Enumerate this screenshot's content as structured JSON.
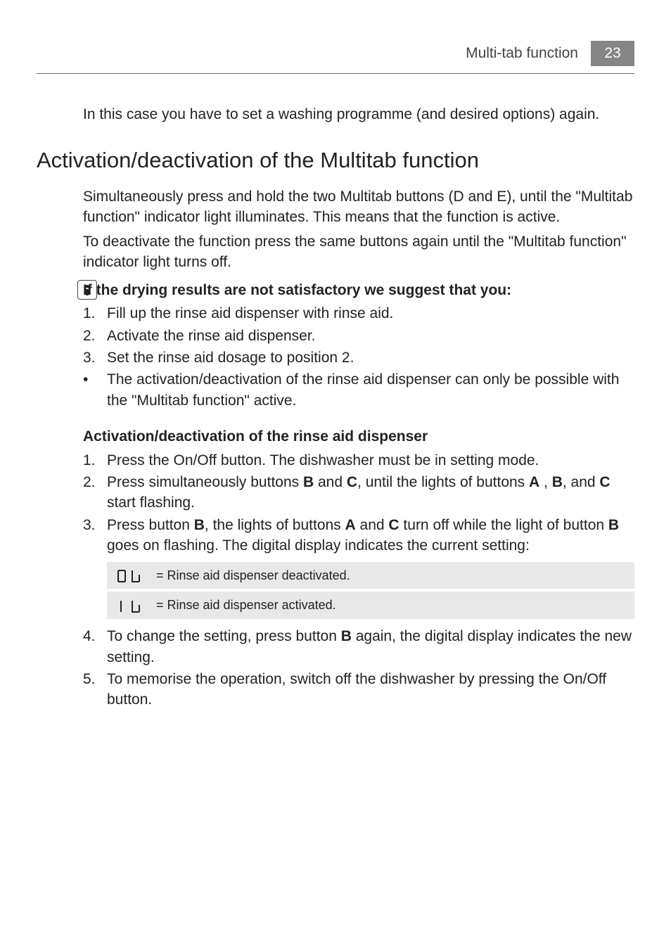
{
  "header": {
    "title": "Multi-tab function",
    "page": "23"
  },
  "intro": "In this case you have to set a washing programme (and desired options) again.",
  "section_heading": "Activation/deactivation of the Multitab function",
  "para1": "Simultaneously press and hold the two Multitab buttons (D and E), until the \"Multitab function\" indicator light illuminates. This means that the function is active.",
  "para2": "To deactivate the function press the same buttons again until the \"Multitab function\" indicator light turns off.",
  "dry_heading": "If the drying results are not satisfactory we suggest that you:",
  "dry_list": {
    "n1": "1.",
    "t1": "Fill up the rinse aid dispenser with rinse aid.",
    "n2": "2.",
    "t2": "Activate the rinse aid dispenser.",
    "n3": "3.",
    "t3": "Set the rinse aid dosage to position 2.",
    "b1": "•",
    "tb1": "The activation/deactivation of the rinse aid dispenser can only be possible with the \"Multitab function\" active."
  },
  "rinse_heading": "Activation/deactivation of the rinse aid dispenser",
  "rinse_list": {
    "n1": "1.",
    "t1": "Press the On/Off button. The dishwasher must be in setting mode.",
    "n2": "2.",
    "t2_a": "Press simultaneously buttons ",
    "t2_b": "B",
    "t2_c": " and ",
    "t2_d": "C",
    "t2_e": ", until the lights of buttons ",
    "t2_f": "A",
    "t2_g": " , ",
    "t2_h": "B",
    "t2_i": ", and ",
    "t2_j": "C",
    "t2_k": " start flashing.",
    "n3": "3.",
    "t3_a": "Press button ",
    "t3_b": "B",
    "t3_c": ", the lights of buttons ",
    "t3_d": "A",
    "t3_e": " and ",
    "t3_f": "C",
    "t3_g": " turn off while the light of button ",
    "t3_h": "B",
    "t3_i": " goes on flashing. The digital display indicates the current setting:",
    "n4": "4.",
    "t4_a": "To change the setting, press button ",
    "t4_b": "B",
    "t4_c": " again, the digital display indicates the new setting.",
    "n5": "5.",
    "t5": "To memorise the operation, switch off the dishwasher by pressing the On/Off button."
  },
  "display": {
    "row1": "= Rinse aid dispenser deactivated.",
    "row2": " = Rinse aid dispenser activated."
  }
}
